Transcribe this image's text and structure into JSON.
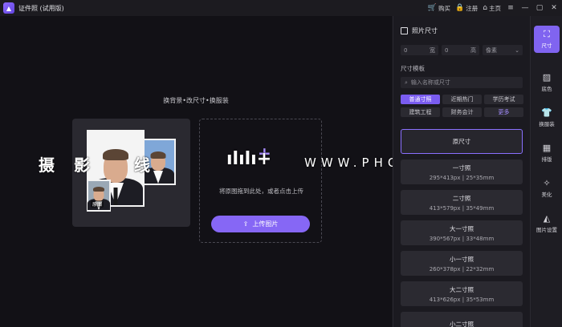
{
  "titlebar": {
    "title": "证件照 (试用版)",
    "buy": "购买",
    "register": "注册",
    "home": "主页"
  },
  "main": {
    "slogan": "换背景•改尺寸•换服装",
    "sample_tag": "原图",
    "drop_hint": "将原图拖到此处，或者点击上传",
    "upload_label": "上传图片"
  },
  "watermark": {
    "cn": "摄影 线",
    "logo": "ılılı+",
    "en": "WWW.PHOTOSKS.VIP"
  },
  "panel": {
    "title": "照片尺寸",
    "width_value": "0",
    "width_unit": "宽",
    "height_value": "0",
    "height_unit": "高",
    "unit_select": "像素",
    "template_label": "尺寸模板",
    "search_placeholder": "输入名称或尺寸",
    "categories": [
      "普通寸照",
      "近期热门",
      "学历考试",
      "建筑工程",
      "财务会计",
      "更多"
    ],
    "sizes": [
      {
        "name": "原尺寸",
        "dims": ""
      },
      {
        "name": "一寸照",
        "dims": "295*413px | 25*35mm"
      },
      {
        "name": "二寸照",
        "dims": "413*579px | 35*49mm"
      },
      {
        "name": "大一寸照",
        "dims": "390*567px | 33*48mm"
      },
      {
        "name": "小一寸照",
        "dims": "260*378px | 22*32mm"
      },
      {
        "name": "大二寸照",
        "dims": "413*626px | 35*53mm"
      },
      {
        "name": "小二寸照",
        "dims": ""
      }
    ]
  },
  "tools": [
    {
      "label": "尺寸",
      "icon": "crop-icon"
    },
    {
      "label": "底色",
      "icon": "background-color-icon"
    },
    {
      "label": "换服装",
      "icon": "shirt-icon"
    },
    {
      "label": "排版",
      "icon": "layout-grid-icon"
    },
    {
      "label": "美化",
      "icon": "magic-wand-icon"
    },
    {
      "label": "图片设置",
      "icon": "image-settings-icon"
    }
  ],
  "colors": {
    "accent": "#8064f0",
    "bg_main": "#121116",
    "panel": "#1b1a20"
  }
}
